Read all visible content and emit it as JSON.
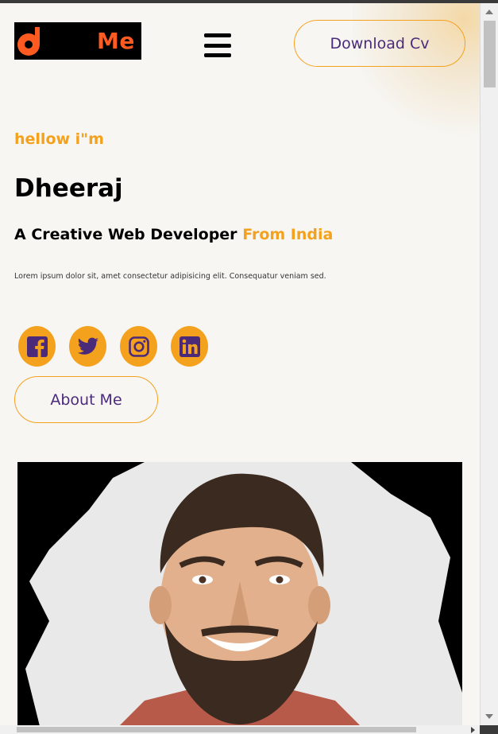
{
  "header": {
    "logo_text": "Me",
    "download_label": "Download Cv"
  },
  "hero": {
    "greeting": "hellow i\"m",
    "name": "Dheeraj",
    "tagline_main": "A Creative Web Developer",
    "tagline_accent": "From India",
    "description": "Lorem ipsum dolor sit, amet consectetur adipisicing elit. Consequatur veniam sed.",
    "about_label": "About Me"
  },
  "socials": [
    {
      "icon": "facebook-icon"
    },
    {
      "icon": "twitter-icon"
    },
    {
      "icon": "instagram-icon"
    },
    {
      "icon": "linkedin-icon"
    }
  ],
  "colors": {
    "accent": "#f4a21d",
    "brand_orange": "#ff5a1f",
    "icon_purple": "#4b2a7a",
    "background": "#f7f6f3"
  }
}
